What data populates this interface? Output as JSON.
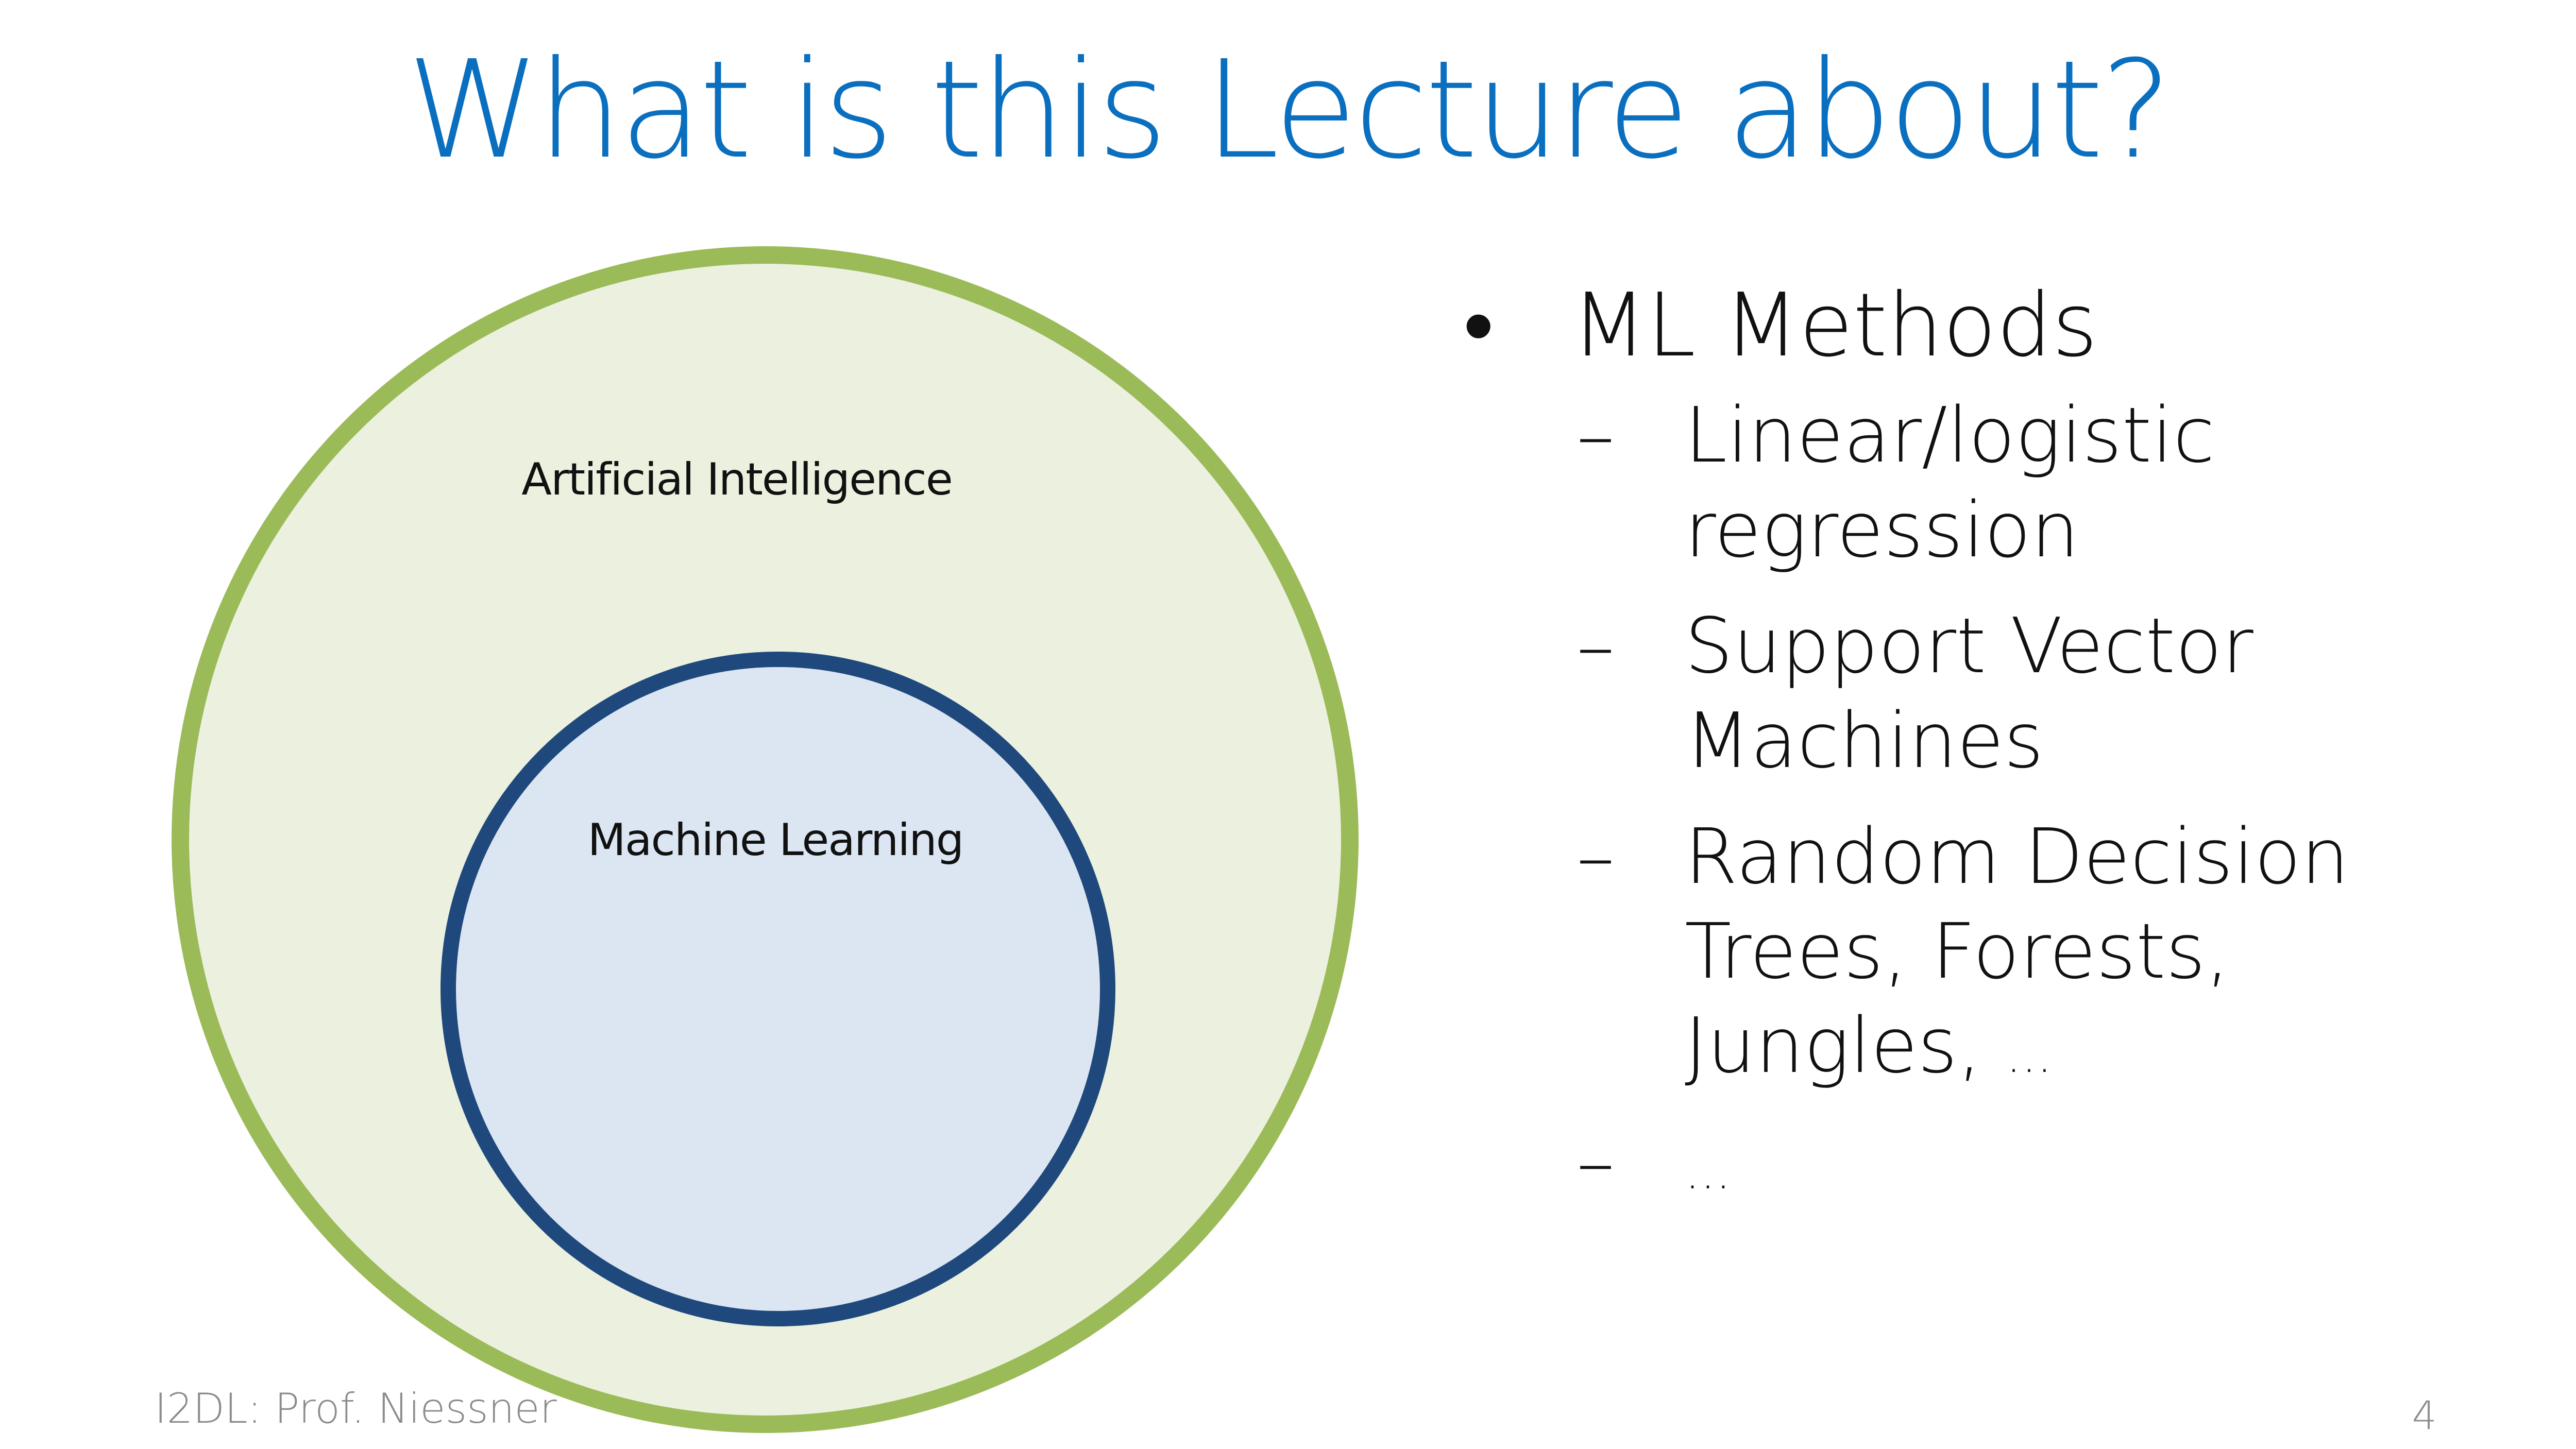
{
  "slide": {
    "title": "What is this Lecture about?"
  },
  "diagram": {
    "outer_label": "Artificial Intelligence",
    "inner_label": "Machine Learning",
    "outer_fill": "#ebf1de",
    "outer_stroke": "#9bbb59",
    "inner_fill": "#dce6f2",
    "inner_stroke": "#1f497d"
  },
  "bullets": {
    "bullet_symbol": "•",
    "dash_symbol": "–",
    "main": "ML Methods",
    "items": [
      {
        "line1": "Linear/logistic",
        "line2": "regression"
      },
      {
        "line1": "Support Vector",
        "line2": "Machines"
      },
      {
        "line1": "Random Decision",
        "line2": "Trees, Forests,",
        "line3": "Jungles,",
        "suffix": "…"
      },
      {
        "suffix": "…"
      }
    ]
  },
  "footer": {
    "left": "I2DL: Prof. Niessner",
    "page_number": "4"
  },
  "colors": {
    "title": "#0b6fbf",
    "footer": "#8c8c8c",
    "text": "#111111"
  }
}
